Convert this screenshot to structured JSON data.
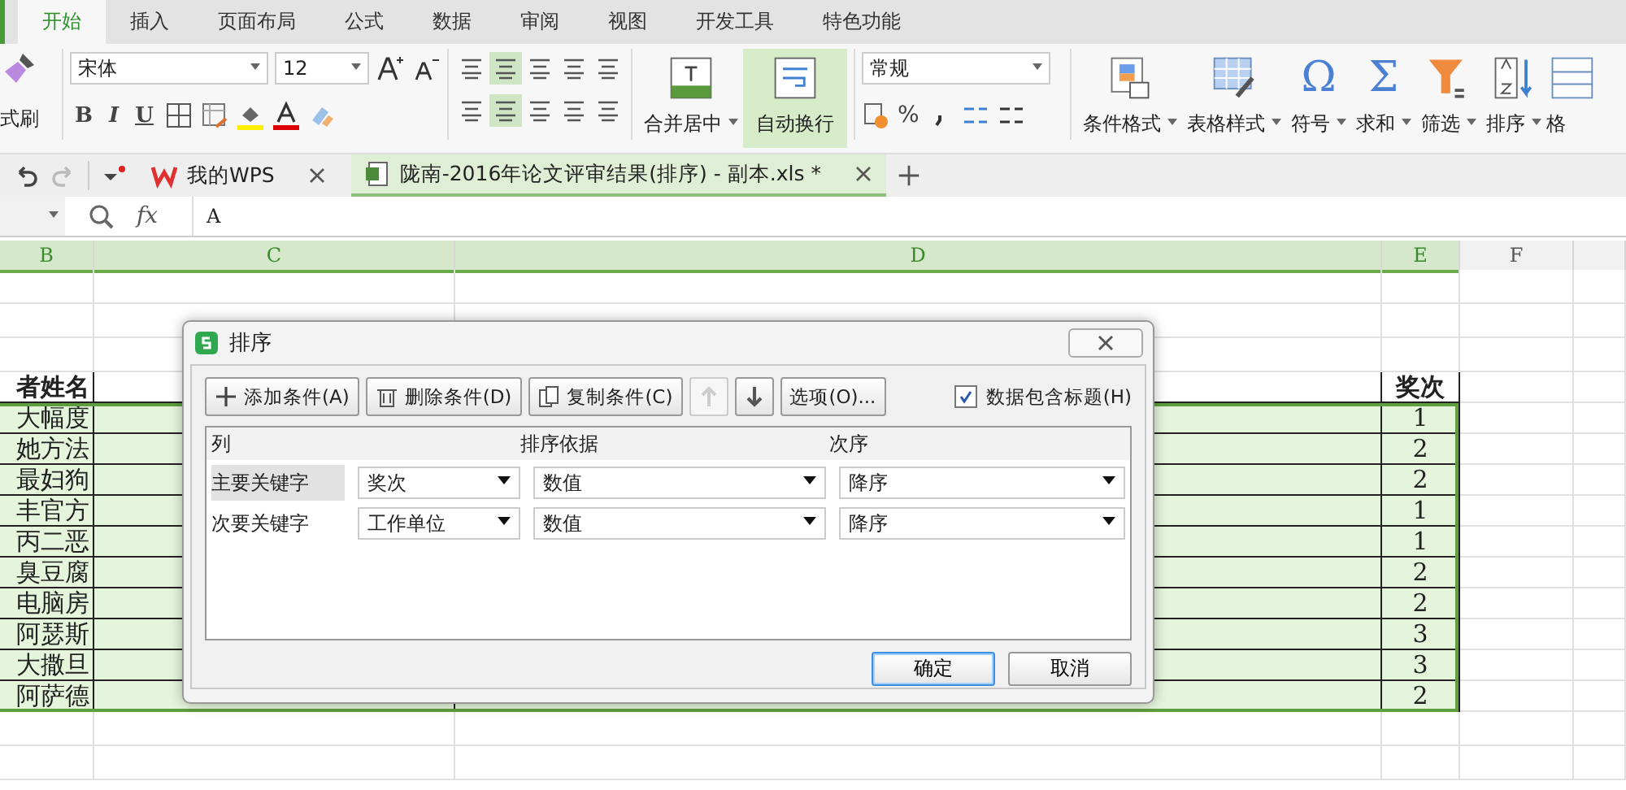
{
  "menu_tabs": [
    {
      "label": "开始",
      "selected": true
    },
    {
      "label": "插入",
      "selected": false
    },
    {
      "label": "页面布局",
      "selected": false
    },
    {
      "label": "公式",
      "selected": false
    },
    {
      "label": "数据",
      "selected": false
    },
    {
      "label": "审阅",
      "selected": false
    },
    {
      "label": "视图",
      "selected": false
    },
    {
      "label": "开发工具",
      "selected": false
    },
    {
      "label": "特色功能",
      "selected": false
    }
  ],
  "ribbon": {
    "format_painter": "式刷",
    "font_name": "宋体",
    "font_size": "12",
    "style_buttons": [
      "B",
      "I",
      "U"
    ],
    "merge_center": "合并居中",
    "wrap_text": {
      "label": "自动换行",
      "selected": true
    },
    "number_format": "常规",
    "percent": "%",
    "large_buttons": [
      {
        "label": "条件格式",
        "kind": "conditional"
      },
      {
        "label": "表格样式",
        "kind": "table_style"
      },
      {
        "label": "符号",
        "kind": "glyph",
        "icon": "Ω"
      },
      {
        "label": "求和",
        "kind": "glyph",
        "icon": "Σ"
      },
      {
        "label": "筛选",
        "kind": "filter"
      },
      {
        "label": "排序",
        "kind": "sort"
      },
      {
        "label": "格",
        "kind": "partial"
      }
    ]
  },
  "doc_tabs": [
    {
      "label": "我的WPS",
      "kind": "home",
      "selected": false
    },
    {
      "label": "陇南-2016年论文评审结果(排序) - 副本.xls *",
      "kind": "sheet",
      "selected": true
    }
  ],
  "formula_bar": {
    "fx": "fx",
    "value": "A"
  },
  "columns": [
    {
      "label": "B",
      "selected": true
    },
    {
      "label": "C",
      "selected": true
    },
    {
      "label": "D",
      "selected": true
    },
    {
      "label": "E",
      "selected": true
    },
    {
      "label": "F",
      "selected": false
    }
  ],
  "sheet": {
    "header": {
      "name": "者姓名",
      "award": "奖次"
    },
    "rows": [
      {
        "name": "大幅度",
        "award": "1"
      },
      {
        "name": "她方法",
        "award": "2"
      },
      {
        "name": "最妇狗",
        "award": "2"
      },
      {
        "name": "丰官方",
        "award": "1"
      },
      {
        "name": "丙二恶",
        "award": "1"
      },
      {
        "name": "臭豆腐",
        "award": "2"
      },
      {
        "name": "电脑房",
        "award": "2"
      },
      {
        "name": "阿瑟斯",
        "award": "3"
      },
      {
        "name": "大撒旦",
        "award": "3"
      },
      {
        "name": "阿萨德",
        "award": "2"
      }
    ]
  },
  "dialog": {
    "title": "排序",
    "toolbar": [
      {
        "kind": "add",
        "label": "添加条件(A)",
        "disabled": false
      },
      {
        "kind": "delete",
        "label": "删除条件(D)",
        "disabled": false
      },
      {
        "kind": "copy",
        "label": "复制条件(C)",
        "disabled": false
      },
      {
        "kind": "up",
        "disabled": true
      },
      {
        "kind": "down",
        "disabled": false
      },
      {
        "kind": "text",
        "label": "选项(O)...",
        "disabled": false
      }
    ],
    "header_checkbox": {
      "label": "数据包含标题(H)",
      "checked": true
    },
    "columns": [
      "列",
      "排序依据",
      "次序"
    ],
    "rows": [
      {
        "label": "主要关键字",
        "selected": true,
        "column": "奖次",
        "sort_on": "数值",
        "order": "降序"
      },
      {
        "label": "次要关键字",
        "selected": false,
        "column": "工作单位",
        "sort_on": "数值",
        "order": "降序"
      }
    ],
    "buttons": [
      {
        "label": "确定",
        "kind": "primary"
      },
      {
        "label": "取消",
        "kind": "normal"
      }
    ]
  }
}
